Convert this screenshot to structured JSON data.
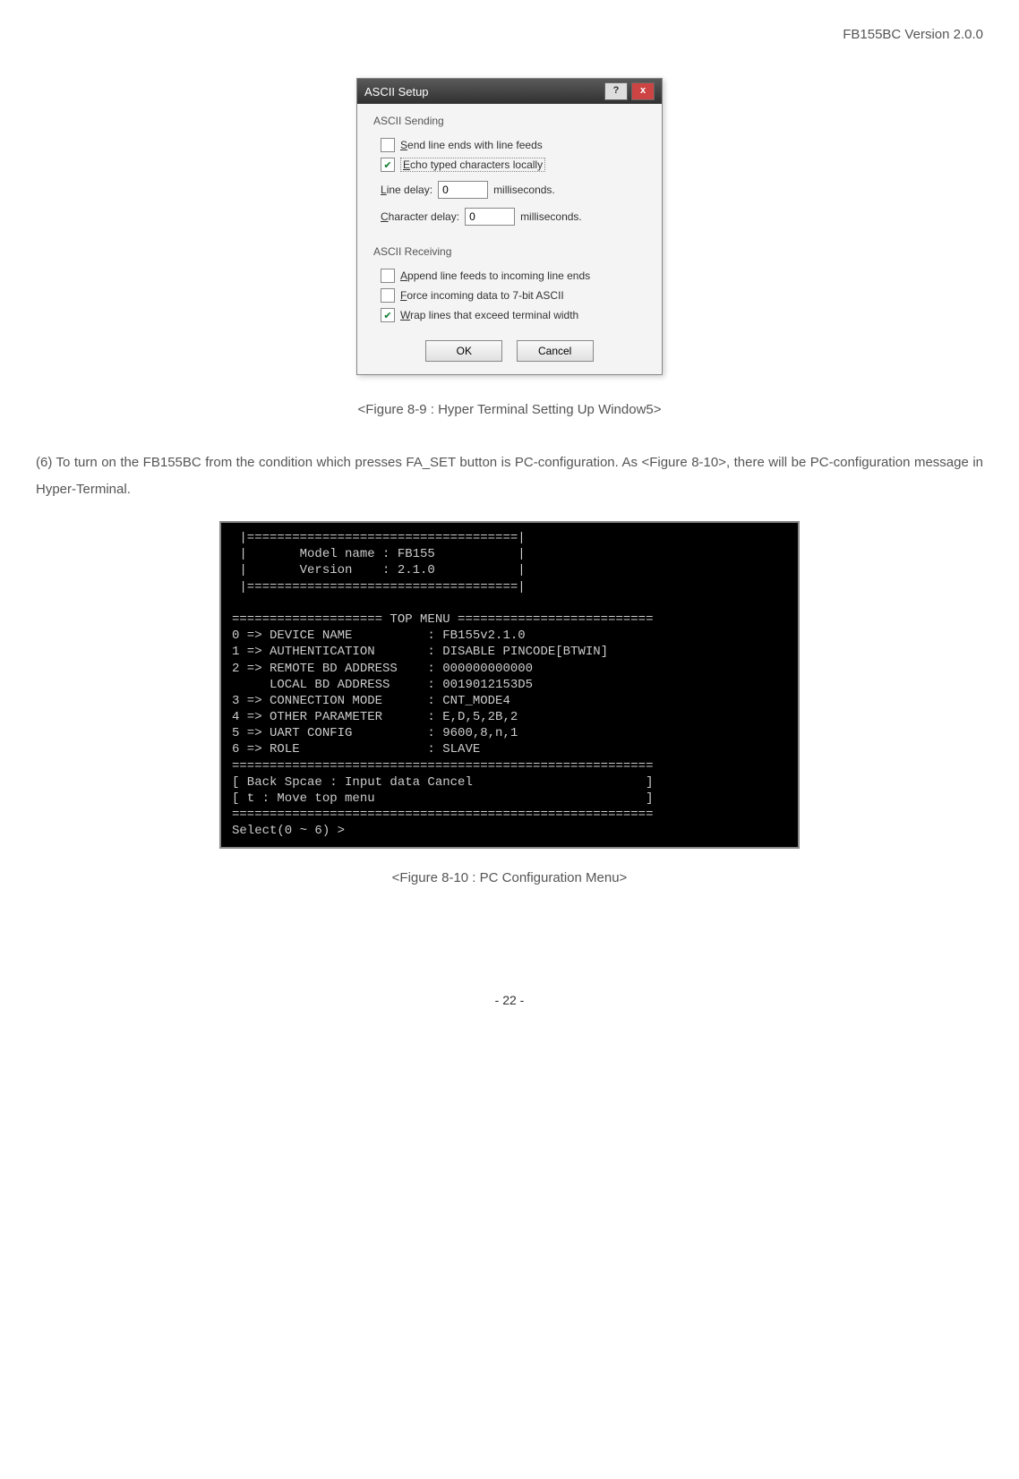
{
  "header": {
    "doc_version": "FB155BC Version 2.0.0"
  },
  "dialog": {
    "title": "ASCII Setup",
    "sending_label": "ASCII Sending",
    "send_line_ends": "Send line ends with line feeds",
    "echo_typed": "Echo typed characters locally",
    "line_delay_label": "Line delay:",
    "line_delay_value": "0",
    "line_delay_units": "milliseconds.",
    "char_delay_label": "Character delay:",
    "char_delay_value": "0",
    "char_delay_units": "milliseconds.",
    "receiving_label": "ASCII Receiving",
    "append_line_feeds": "Append line feeds to incoming line ends",
    "force_7bit": "Force incoming data to 7-bit ASCII",
    "wrap_lines": "Wrap lines that exceed terminal width",
    "ok": "OK",
    "cancel": "Cancel"
  },
  "caption1": "<Figure 8-9 : Hyper Terminal Setting Up Window5>",
  "body_text": "(6) To turn on the FB155BC from the condition which presses FA_SET button is PC-configuration. As <Figure 8-10>, there will be PC-configuration message in Hyper-Terminal.",
  "terminal_text": " |====================================|\n |       Model name : FB155           |\n |       Version    : 2.1.0           |\n |====================================|\n\n==================== TOP MENU ==========================\n0 => DEVICE NAME          : FB155v2.1.0\n1 => AUTHENTICATION       : DISABLE PINCODE[BTWIN]\n2 => REMOTE BD ADDRESS    : 000000000000\n     LOCAL BD ADDRESS     : 0019012153D5\n3 => CONNECTION MODE      : CNT_MODE4\n4 => OTHER PARAMETER      : E,D,5,2B,2\n5 => UART CONFIG          : 9600,8,n,1\n6 => ROLE                 : SLAVE\n========================================================\n[ Back Spcae : Input data Cancel                       ]\n[ t : Move top menu                                    ]\n========================================================\nSelect(0 ~ 6) >",
  "caption2": "<Figure 8-10 : PC Configuration Menu>",
  "page_number": "- 22 -",
  "chart_data": {
    "type": "table",
    "title": "TOP MENU",
    "model_name": "FB155",
    "version": "2.1.0",
    "rows": [
      {
        "index": "0",
        "item": "DEVICE NAME",
        "value": "FB155v2.1.0"
      },
      {
        "index": "1",
        "item": "AUTHENTICATION",
        "value": "DISABLE PINCODE[BTWIN]"
      },
      {
        "index": "2",
        "item": "REMOTE BD ADDRESS",
        "value": "000000000000"
      },
      {
        "index": "",
        "item": "LOCAL BD ADDRESS",
        "value": "0019012153D5"
      },
      {
        "index": "3",
        "item": "CONNECTION MODE",
        "value": "CNT_MODE4"
      },
      {
        "index": "4",
        "item": "OTHER PARAMETER",
        "value": "E,D,5,2B,2"
      },
      {
        "index": "5",
        "item": "UART CONFIG",
        "value": "9600,8,n,1"
      },
      {
        "index": "6",
        "item": "ROLE",
        "value": "SLAVE"
      }
    ],
    "footer": [
      "Back Spcae : Input data Cancel",
      "t : Move top menu"
    ],
    "prompt": "Select(0 ~ 6) >"
  }
}
